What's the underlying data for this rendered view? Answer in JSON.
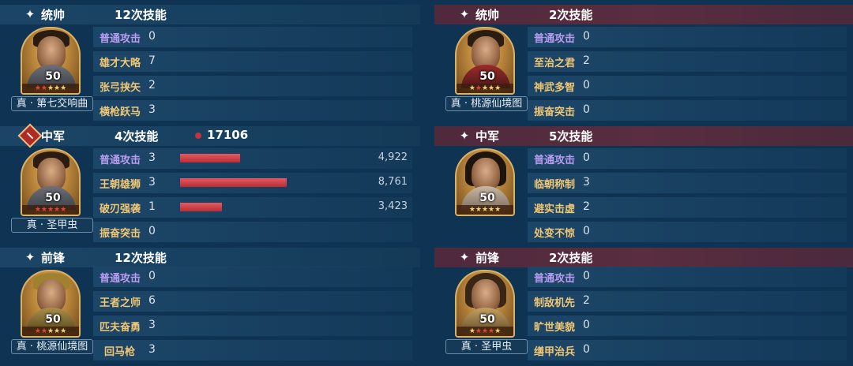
{
  "colors": {
    "background": "#0f3353",
    "left_header": "#1c4466",
    "right_header": "#5a2d40",
    "skill_gold": "#f0c774",
    "skill_normal": "#b89cf0",
    "bar_red": "#c0343b"
  },
  "left": [
    {
      "role": "统帅",
      "count": "12次技能",
      "icon": "star-icon",
      "level": "50",
      "stars": {
        "red": 2,
        "yellow": 3
      },
      "tag": "真 · 第七交响曲",
      "skills": [
        {
          "name": "普通攻击",
          "value": "0",
          "normal": true
        },
        {
          "name": "雄才大略",
          "value": "7"
        },
        {
          "name": "张弓挟矢",
          "value": "2"
        },
        {
          "name": "横枪跃马",
          "value": "3"
        }
      ]
    },
    {
      "role": "中军",
      "count": "4次技能",
      "icon": "role-badge-icon",
      "total": "17106",
      "level": "50",
      "stars": {
        "red": 5,
        "yellow": 0
      },
      "tag": "真 · 圣甲虫",
      "skills": [
        {
          "name": "普通攻击",
          "value": "3",
          "normal": true,
          "damage": "4,922",
          "damage_value": 4922
        },
        {
          "name": "王朝雄狮",
          "value": "3",
          "damage": "8,761",
          "damage_value": 8761
        },
        {
          "name": "破刃强袭",
          "value": "1",
          "damage": "3,423",
          "damage_value": 3423
        },
        {
          "name": "振奋突击",
          "value": "0"
        }
      ]
    },
    {
      "role": "前锋",
      "count": "12次技能",
      "icon": "star-icon",
      "level": "50",
      "stars": {
        "red": 2,
        "yellow": 3
      },
      "tag": "真 · 桃源仙境图",
      "skills": [
        {
          "name": "普通攻击",
          "value": "0",
          "normal": true
        },
        {
          "name": "王者之师",
          "value": "6"
        },
        {
          "name": "匹夫奋勇",
          "value": "3"
        },
        {
          "name": "回马枪",
          "value": "3"
        }
      ]
    }
  ],
  "right": [
    {
      "role": "统帅",
      "count": "2次技能",
      "icon": "star-icon",
      "level": "50",
      "stars": {
        "red": 2,
        "yellow": 3
      },
      "tag": "真 · 桃源仙境图",
      "skills": [
        {
          "name": "普通攻击",
          "value": "0",
          "normal": true
        },
        {
          "name": "至治之君",
          "value": "2"
        },
        {
          "name": "神武多智",
          "value": "0"
        },
        {
          "name": "振奋突击",
          "value": "0"
        }
      ]
    },
    {
      "role": "中军",
      "count": "5次技能",
      "icon": "star-icon",
      "level": "50",
      "stars": {
        "red": 0,
        "yellow": 5
      },
      "tag": "",
      "skills": [
        {
          "name": "普通攻击",
          "value": "0",
          "normal": true
        },
        {
          "name": "临朝称制",
          "value": "3"
        },
        {
          "name": "避实击虚",
          "value": "2"
        },
        {
          "name": "处变不惊",
          "value": "0"
        }
      ]
    },
    {
      "role": "前锋",
      "count": "2次技能",
      "icon": "star-icon",
      "level": "50",
      "stars": {
        "red": 3,
        "yellow": 2
      },
      "tag": "真 · 圣甲虫",
      "skills": [
        {
          "name": "普通攻击",
          "value": "0",
          "normal": true
        },
        {
          "name": "制敌机先",
          "value": "2"
        },
        {
          "name": "旷世美貌",
          "value": "0"
        },
        {
          "name": "缮甲治兵",
          "value": "0"
        }
      ]
    }
  ]
}
